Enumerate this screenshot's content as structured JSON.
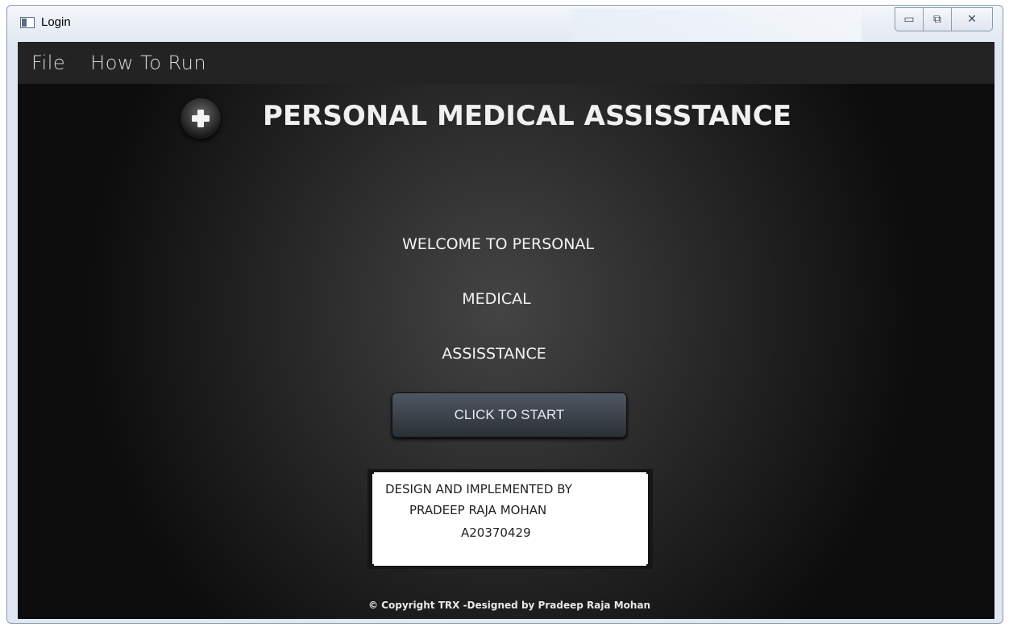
{
  "window": {
    "title": "Login",
    "controls": {
      "minimize": "▭",
      "restore": "⧉",
      "close": "✕"
    }
  },
  "menu": {
    "items": [
      {
        "label": "File"
      },
      {
        "label": "How To Run"
      }
    ]
  },
  "header": {
    "logo_icon": "medical-cross-icon",
    "title": "PERSONAL MEDICAL ASSISSTANCE"
  },
  "welcome": {
    "line1": "WELCOME TO PERSONAL",
    "line2": "MEDICAL",
    "line3": "ASSISSTANCE"
  },
  "start_button": {
    "label": "CLICK TO START"
  },
  "credits": {
    "line1": "DESIGN AND IMPLEMENTED BY",
    "line2": "PRADEEP RAJA MOHAN",
    "line3": "A20370429"
  },
  "footer": {
    "copyright": "© Copyright TRX -Designed by Pradeep Raja Mohan"
  },
  "colors": {
    "menubar_bg": "#232323",
    "client_center": "#444444",
    "client_edge": "#0c0c0c",
    "button_top": "#4e5761",
    "button_bottom": "#2a3036"
  }
}
